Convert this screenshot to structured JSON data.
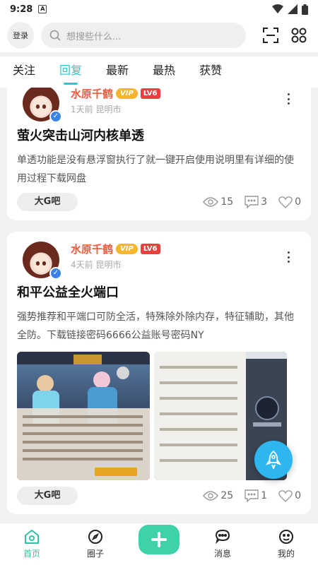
{
  "status": {
    "time": "9:28",
    "a_icon": "A"
  },
  "header": {
    "login_label": "登录",
    "search_placeholder": "想搜些什么..."
  },
  "tabs": [
    {
      "label": "关注",
      "active": false
    },
    {
      "label": "回复",
      "active": true
    },
    {
      "label": "最新",
      "active": false
    },
    {
      "label": "最热",
      "active": false
    },
    {
      "label": "获赞",
      "active": false
    }
  ],
  "posts": [
    {
      "username": "水原千鹤",
      "vip": "VIP",
      "level": "LV6",
      "meta": "1天前 昆明市",
      "title": "萤火突击山河内核单透",
      "body": "单透功能是没有悬浮窗执行了就一键开启使用说明里有详细的使用过程下载网盘",
      "tag": "大G吧",
      "views": "15",
      "comments": "3",
      "likes": "0"
    },
    {
      "username": "水原千鹤",
      "vip": "VIP",
      "level": "LV6",
      "meta": "4天前 昆明市",
      "title": "和平公益全火端口",
      "body": "强势推荐和平端口可防全活，特殊除外除内存，特征辅助，其他全防。下载链接密码6666公益账号密码NY",
      "tag": "大G吧",
      "views": "25",
      "comments": "1",
      "likes": "0"
    }
  ],
  "bottom_nav": [
    {
      "label": "首页",
      "icon": "home-icon",
      "active": true
    },
    {
      "label": "圈子",
      "icon": "compass-icon",
      "active": false
    },
    {
      "label": "",
      "icon": "plus-icon",
      "active": false
    },
    {
      "label": "消息",
      "icon": "chat-icon",
      "active": false
    },
    {
      "label": "我的",
      "icon": "face-icon",
      "active": false
    }
  ],
  "colors": {
    "accent": "#2ec4d4",
    "username": "#f05a3c",
    "fab": "#2eb6f0",
    "plus": "#3ed2a8"
  }
}
